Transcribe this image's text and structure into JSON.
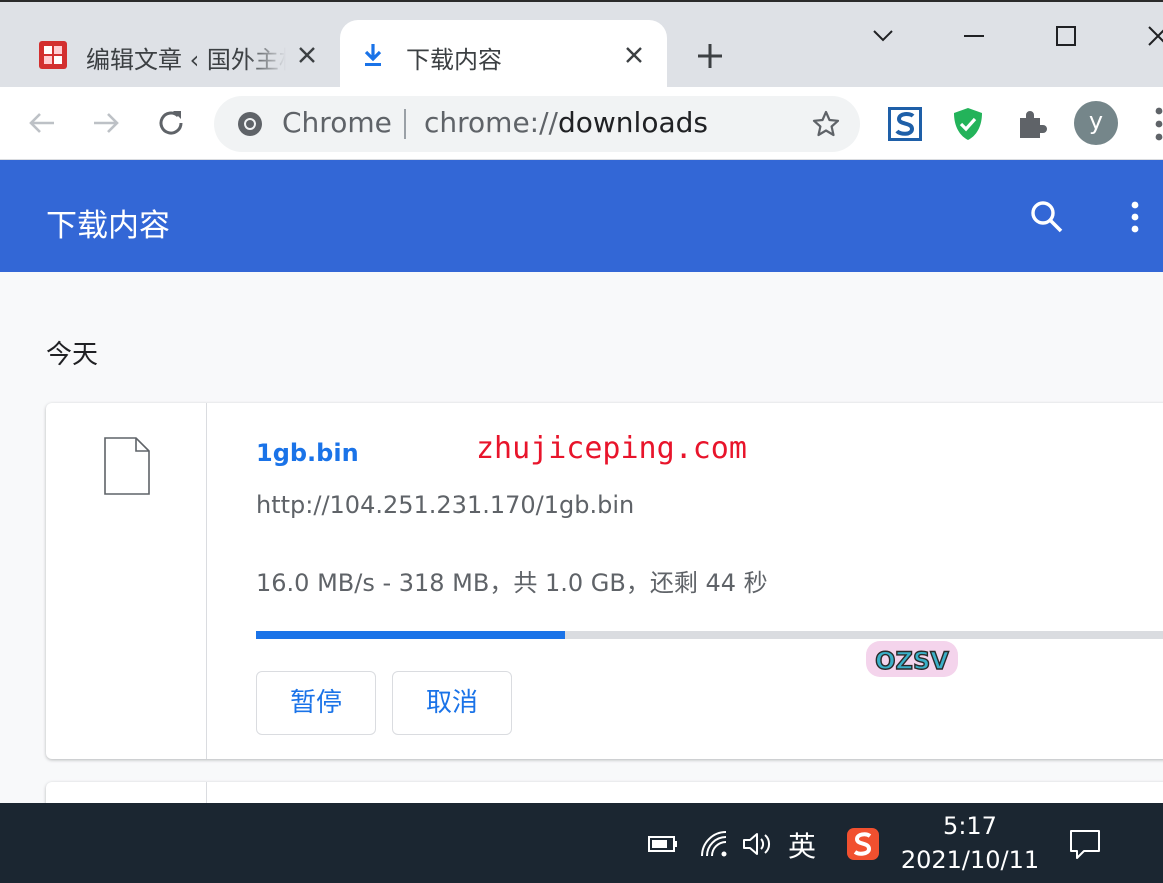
{
  "browser": {
    "tabs": [
      {
        "title": "编辑文章 ‹ 国外主机",
        "active": false
      },
      {
        "title": "下载内容",
        "active": true
      }
    ],
    "site_chip": "Chrome",
    "url_scheme": "chrome://",
    "url_host": "downloads",
    "avatar_letter": "y"
  },
  "downloads": {
    "title": "下载内容",
    "date_heading": "今天",
    "items": [
      {
        "file_name": "1gb.bin",
        "url": "http://104.251.231.170/1gb.bin",
        "status": "16.0 MB/s - 318 MB，共 1.0 GB，还剩 44 秒",
        "progress_fraction": 0.336,
        "pause_label": "暂停",
        "cancel_label": "取消"
      }
    ]
  },
  "watermark": "zhujiceping.com",
  "sticker_text": "OZSV",
  "taskbar": {
    "ime_lang": "英",
    "time": "5:17",
    "date": "2021/10/11"
  },
  "colors": {
    "accent": "#3367d6",
    "link": "#1a73e8",
    "watermark": "#e8142b",
    "taskbar": "#1b2631"
  }
}
